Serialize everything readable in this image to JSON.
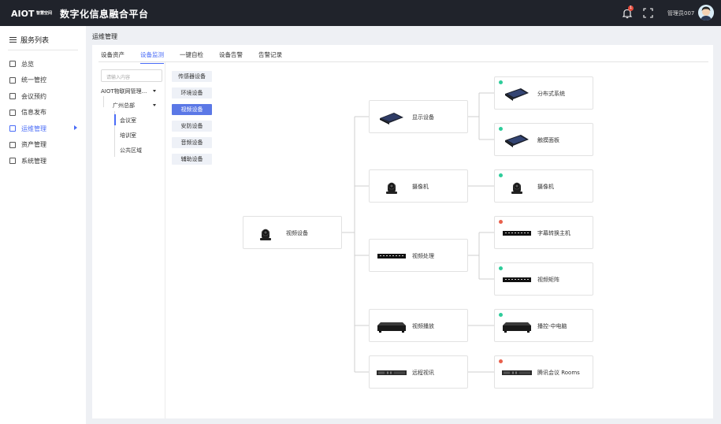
{
  "header": {
    "logo": "AIOT",
    "logo_sub": "智慧空间",
    "app_title": "数字化信息融合平台",
    "notification_count": "1",
    "username": "管理员007"
  },
  "sidebar": {
    "title": "服务列表",
    "items": [
      {
        "label": "总览",
        "icon": "overview-icon"
      },
      {
        "label": "统一管控",
        "icon": "control-icon"
      },
      {
        "label": "会议预约",
        "icon": "calendar-icon"
      },
      {
        "label": "信息发布",
        "icon": "publish-icon"
      },
      {
        "label": "运维管理",
        "icon": "ops-icon",
        "active": true
      },
      {
        "label": "资产管理",
        "icon": "asset-icon"
      },
      {
        "label": "系统管理",
        "icon": "system-icon"
      }
    ]
  },
  "main": {
    "title": "运维管理",
    "tabs": [
      "设备资产",
      "设备监测",
      "一键自检",
      "设备告警",
      "告警记录"
    ],
    "active_tab": "设备监测",
    "search_placeholder": "请输入内容",
    "tree": {
      "root": "AIOT物联网管理...",
      "branch": "广州总部",
      "leaves": [
        "会议室",
        "培训室",
        "公共区域"
      ],
      "selected": "会议室"
    },
    "categories": [
      "传感器设备",
      "环境设备",
      "视频设备",
      "安防设备",
      "音频设备",
      "辅助设备"
    ],
    "active_category": "视频设备"
  },
  "diagram": {
    "root": {
      "label": "视频设备",
      "icon": "camera-icon"
    },
    "groups": [
      {
        "label": "显示设备",
        "icon": "display-device-icon",
        "children": [
          {
            "label": "分布式系统",
            "icon": "tablet-device-icon",
            "status": "online"
          },
          {
            "label": "触摸面板",
            "icon": "tablet-device-icon",
            "status": "online"
          }
        ]
      },
      {
        "label": "摄像机",
        "icon": "camera-icon",
        "children": [
          {
            "label": "摄像机",
            "icon": "camera-icon",
            "status": "online"
          }
        ]
      },
      {
        "label": "视频处理",
        "icon": "rack-device-icon",
        "children": [
          {
            "label": "字幕转换主机",
            "icon": "rack-device-icon",
            "status": "offline"
          },
          {
            "label": "视频矩阵",
            "icon": "rack-device-icon",
            "status": "online"
          }
        ]
      },
      {
        "label": "视频播放",
        "icon": "player-box-icon",
        "children": [
          {
            "label": "播控-中电脑",
            "icon": "player-box-icon",
            "status": "online"
          }
        ]
      },
      {
        "label": "远程视讯",
        "icon": "codec-device-icon",
        "children": [
          {
            "label": "腾讯会议 Rooms",
            "icon": "codec-device-icon",
            "status": "offline"
          }
        ]
      }
    ],
    "status_colors": {
      "online": "#2ecc9a",
      "offline": "#e8604c"
    }
  }
}
